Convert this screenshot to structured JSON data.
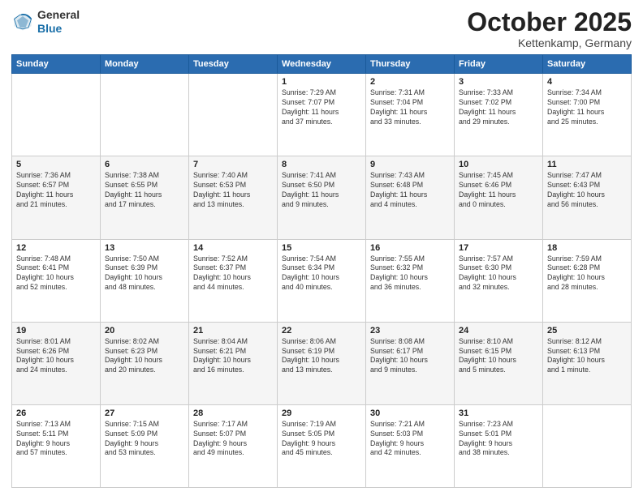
{
  "logo": {
    "general": "General",
    "blue": "Blue"
  },
  "header": {
    "month": "October 2025",
    "location": "Kettenkamp, Germany"
  },
  "days_of_week": [
    "Sunday",
    "Monday",
    "Tuesday",
    "Wednesday",
    "Thursday",
    "Friday",
    "Saturday"
  ],
  "weeks": [
    [
      {
        "day": "",
        "info": ""
      },
      {
        "day": "",
        "info": ""
      },
      {
        "day": "",
        "info": ""
      },
      {
        "day": "1",
        "info": "Sunrise: 7:29 AM\nSunset: 7:07 PM\nDaylight: 11 hours\nand 37 minutes."
      },
      {
        "day": "2",
        "info": "Sunrise: 7:31 AM\nSunset: 7:04 PM\nDaylight: 11 hours\nand 33 minutes."
      },
      {
        "day": "3",
        "info": "Sunrise: 7:33 AM\nSunset: 7:02 PM\nDaylight: 11 hours\nand 29 minutes."
      },
      {
        "day": "4",
        "info": "Sunrise: 7:34 AM\nSunset: 7:00 PM\nDaylight: 11 hours\nand 25 minutes."
      }
    ],
    [
      {
        "day": "5",
        "info": "Sunrise: 7:36 AM\nSunset: 6:57 PM\nDaylight: 11 hours\nand 21 minutes."
      },
      {
        "day": "6",
        "info": "Sunrise: 7:38 AM\nSunset: 6:55 PM\nDaylight: 11 hours\nand 17 minutes."
      },
      {
        "day": "7",
        "info": "Sunrise: 7:40 AM\nSunset: 6:53 PM\nDaylight: 11 hours\nand 13 minutes."
      },
      {
        "day": "8",
        "info": "Sunrise: 7:41 AM\nSunset: 6:50 PM\nDaylight: 11 hours\nand 9 minutes."
      },
      {
        "day": "9",
        "info": "Sunrise: 7:43 AM\nSunset: 6:48 PM\nDaylight: 11 hours\nand 4 minutes."
      },
      {
        "day": "10",
        "info": "Sunrise: 7:45 AM\nSunset: 6:46 PM\nDaylight: 11 hours\nand 0 minutes."
      },
      {
        "day": "11",
        "info": "Sunrise: 7:47 AM\nSunset: 6:43 PM\nDaylight: 10 hours\nand 56 minutes."
      }
    ],
    [
      {
        "day": "12",
        "info": "Sunrise: 7:48 AM\nSunset: 6:41 PM\nDaylight: 10 hours\nand 52 minutes."
      },
      {
        "day": "13",
        "info": "Sunrise: 7:50 AM\nSunset: 6:39 PM\nDaylight: 10 hours\nand 48 minutes."
      },
      {
        "day": "14",
        "info": "Sunrise: 7:52 AM\nSunset: 6:37 PM\nDaylight: 10 hours\nand 44 minutes."
      },
      {
        "day": "15",
        "info": "Sunrise: 7:54 AM\nSunset: 6:34 PM\nDaylight: 10 hours\nand 40 minutes."
      },
      {
        "day": "16",
        "info": "Sunrise: 7:55 AM\nSunset: 6:32 PM\nDaylight: 10 hours\nand 36 minutes."
      },
      {
        "day": "17",
        "info": "Sunrise: 7:57 AM\nSunset: 6:30 PM\nDaylight: 10 hours\nand 32 minutes."
      },
      {
        "day": "18",
        "info": "Sunrise: 7:59 AM\nSunset: 6:28 PM\nDaylight: 10 hours\nand 28 minutes."
      }
    ],
    [
      {
        "day": "19",
        "info": "Sunrise: 8:01 AM\nSunset: 6:26 PM\nDaylight: 10 hours\nand 24 minutes."
      },
      {
        "day": "20",
        "info": "Sunrise: 8:02 AM\nSunset: 6:23 PM\nDaylight: 10 hours\nand 20 minutes."
      },
      {
        "day": "21",
        "info": "Sunrise: 8:04 AM\nSunset: 6:21 PM\nDaylight: 10 hours\nand 16 minutes."
      },
      {
        "day": "22",
        "info": "Sunrise: 8:06 AM\nSunset: 6:19 PM\nDaylight: 10 hours\nand 13 minutes."
      },
      {
        "day": "23",
        "info": "Sunrise: 8:08 AM\nSunset: 6:17 PM\nDaylight: 10 hours\nand 9 minutes."
      },
      {
        "day": "24",
        "info": "Sunrise: 8:10 AM\nSunset: 6:15 PM\nDaylight: 10 hours\nand 5 minutes."
      },
      {
        "day": "25",
        "info": "Sunrise: 8:12 AM\nSunset: 6:13 PM\nDaylight: 10 hours\nand 1 minute."
      }
    ],
    [
      {
        "day": "26",
        "info": "Sunrise: 7:13 AM\nSunset: 5:11 PM\nDaylight: 9 hours\nand 57 minutes."
      },
      {
        "day": "27",
        "info": "Sunrise: 7:15 AM\nSunset: 5:09 PM\nDaylight: 9 hours\nand 53 minutes."
      },
      {
        "day": "28",
        "info": "Sunrise: 7:17 AM\nSunset: 5:07 PM\nDaylight: 9 hours\nand 49 minutes."
      },
      {
        "day": "29",
        "info": "Sunrise: 7:19 AM\nSunset: 5:05 PM\nDaylight: 9 hours\nand 45 minutes."
      },
      {
        "day": "30",
        "info": "Sunrise: 7:21 AM\nSunset: 5:03 PM\nDaylight: 9 hours\nand 42 minutes."
      },
      {
        "day": "31",
        "info": "Sunrise: 7:23 AM\nSunset: 5:01 PM\nDaylight: 9 hours\nand 38 minutes."
      },
      {
        "day": "",
        "info": ""
      }
    ]
  ]
}
